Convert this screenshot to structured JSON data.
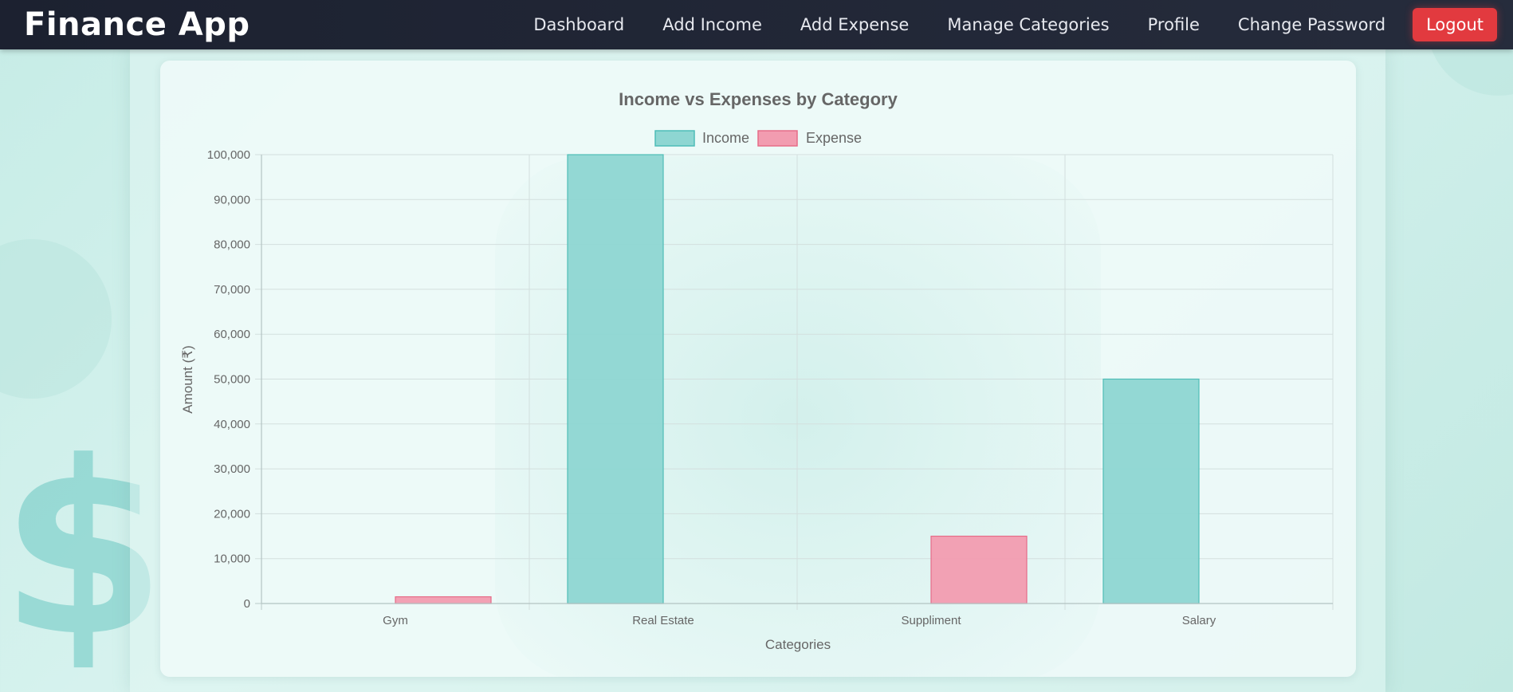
{
  "navbar": {
    "brand": "Finance App",
    "links": [
      "Dashboard",
      "Add Income",
      "Add Expense",
      "Manage Categories",
      "Profile",
      "Change Password"
    ],
    "logout_label": "Logout"
  },
  "background": {
    "dollar_glyph": "$"
  },
  "colors": {
    "income_fill": "#8ed6d2",
    "income_stroke": "#4fbdb7",
    "expense_fill": "#f29cb0",
    "expense_stroke": "#e66c88",
    "navbar": "#1e2332",
    "logout": "#e23a3f"
  },
  "chart_data": {
    "type": "bar",
    "title": "Income vs Expenses by Category",
    "xlabel": "Categories",
    "ylabel": "Amount (₹)",
    "categories": [
      "Gym",
      "Real Estate",
      "Suppliment",
      "Salary"
    ],
    "series": [
      {
        "name": "Income",
        "values": [
          0,
          100000,
          0,
          50000
        ]
      },
      {
        "name": "Expense",
        "values": [
          1500,
          0,
          15000,
          0
        ]
      }
    ],
    "ylim": [
      0,
      100000
    ],
    "yticks": [
      "0",
      "10,000",
      "20,000",
      "30,000",
      "40,000",
      "50,000",
      "60,000",
      "70,000",
      "80,000",
      "90,000",
      "100,000"
    ],
    "grid": true,
    "legend": "top"
  }
}
